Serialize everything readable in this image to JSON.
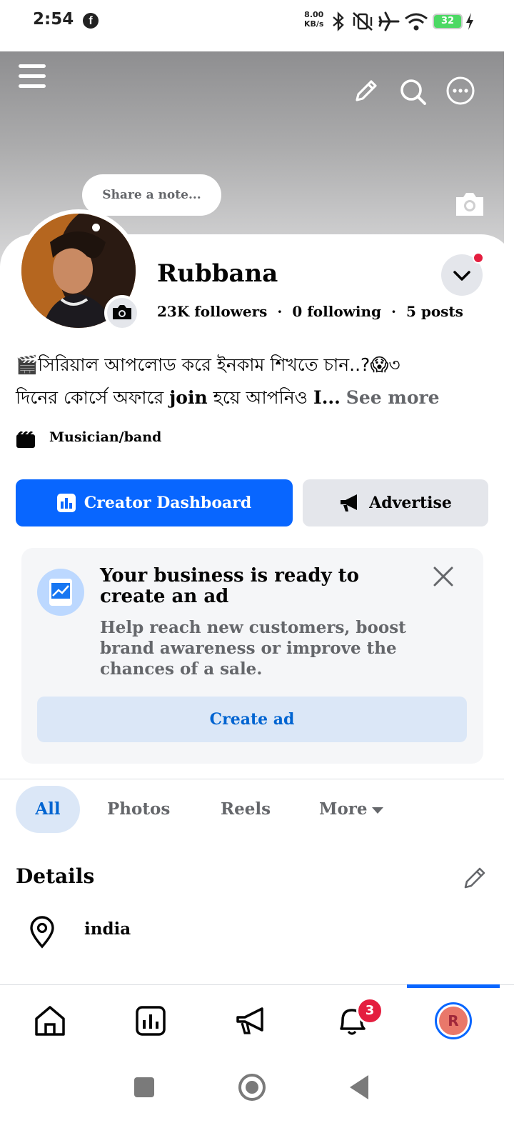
{
  "status_bar": {
    "time": "2:54",
    "net_speed_value": "8.00",
    "net_speed_unit": "KB/s",
    "battery": "32"
  },
  "profile": {
    "note_placeholder": "Share a note...",
    "name": "Rubbana",
    "followers": "23K",
    "followers_label": "followers",
    "following": "0",
    "following_label": "following",
    "posts": "5",
    "posts_label": "posts",
    "bio_line1": "🎬সিরিয়াল আপলোড করে ইনকাম শিখতে চান..?😱৩",
    "bio_line2_prefix": "দিনের কোর্সে অফারে ",
    "bio_join": "join",
    "bio_line2_mid": " হয়ে আপনিও ",
    "bio_trunc": "I...",
    "see_more": "See more",
    "category": "Musician/band"
  },
  "actions": {
    "creator_dashboard": "Creator Dashboard",
    "advertise": "Advertise"
  },
  "ad_card": {
    "title": "Your business is ready to create an ad",
    "description": "Help reach new customers, boost brand awareness or improve the chances of a sale.",
    "button": "Create ad"
  },
  "tabs": [
    {
      "label": "All",
      "active": true
    },
    {
      "label": "Photos",
      "active": false
    },
    {
      "label": "Reels",
      "active": false
    },
    {
      "label": "More",
      "active": false
    }
  ],
  "details": {
    "title": "Details",
    "location": "india"
  },
  "bottom_nav": {
    "notification_count": "3",
    "avatar_initial": "R"
  },
  "colors": {
    "primary": "#0866ff",
    "badge": "#e41e3f",
    "secondary_text": "#65676b"
  }
}
